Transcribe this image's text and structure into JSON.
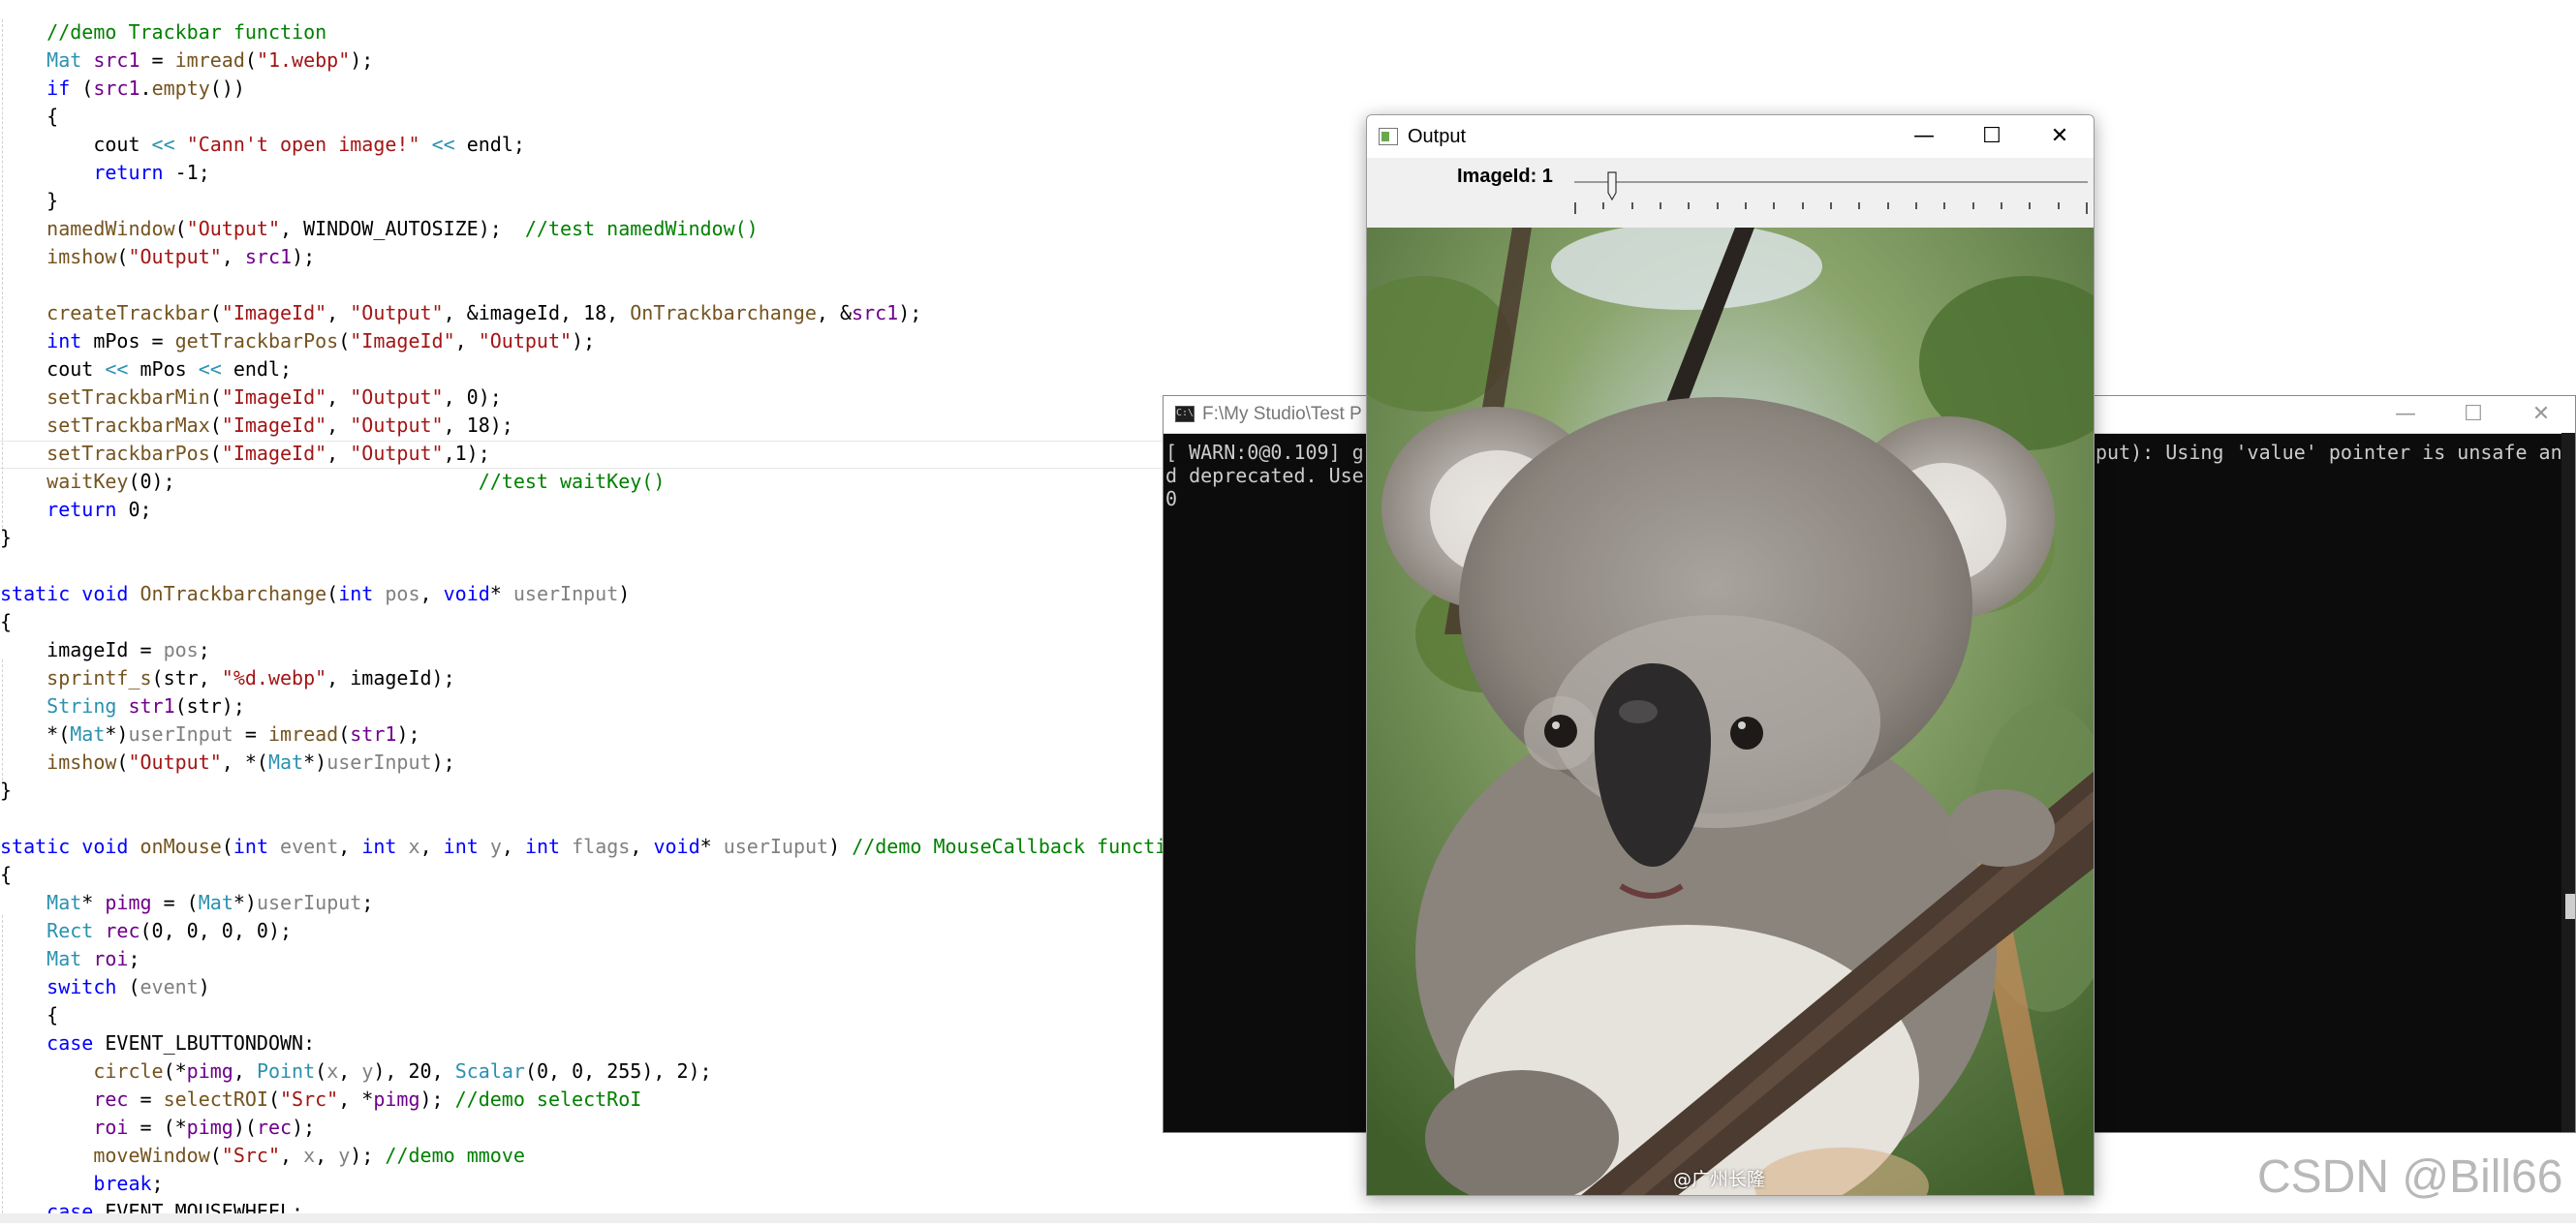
{
  "editor": {
    "lines": [
      [
        {
          "t": "    "
        },
        {
          "t": "//demo Trackbar function",
          "c": "cm"
        }
      ],
      [
        {
          "t": "    "
        },
        {
          "t": "Mat",
          "c": "ty"
        },
        {
          "t": " "
        },
        {
          "t": "src1",
          "c": "mc"
        },
        {
          "t": " = "
        },
        {
          "t": "imread",
          "c": "fn"
        },
        {
          "t": "("
        },
        {
          "t": "\"1.webp\"",
          "c": "st"
        },
        {
          "t": ");"
        }
      ],
      [
        {
          "t": "    "
        },
        {
          "t": "if",
          "c": "kw"
        },
        {
          "t": " ("
        },
        {
          "t": "src1",
          "c": "mc"
        },
        {
          "t": "."
        },
        {
          "t": "empty",
          "c": "fn"
        },
        {
          "t": "())"
        }
      ],
      [
        {
          "t": "    {"
        }
      ],
      [
        {
          "t": "        cout "
        },
        {
          "t": "<<",
          "c": "ty"
        },
        {
          "t": " "
        },
        {
          "t": "\"Cann't open image!\"",
          "c": "st"
        },
        {
          "t": " "
        },
        {
          "t": "<<",
          "c": "ty"
        },
        {
          "t": " endl;"
        }
      ],
      [
        {
          "t": "        "
        },
        {
          "t": "return",
          "c": "kw"
        },
        {
          "t": " -1;"
        }
      ],
      [
        {
          "t": "    }"
        }
      ],
      [
        {
          "t": "    "
        },
        {
          "t": "namedWindow",
          "c": "fn"
        },
        {
          "t": "("
        },
        {
          "t": "\"Output\"",
          "c": "st"
        },
        {
          "t": ", WINDOW_AUTOSIZE);  "
        },
        {
          "t": "//test namedWindow()",
          "c": "cm"
        }
      ],
      [
        {
          "t": "    "
        },
        {
          "t": "imshow",
          "c": "fn"
        },
        {
          "t": "("
        },
        {
          "t": "\"Output\"",
          "c": "st"
        },
        {
          "t": ", "
        },
        {
          "t": "src1",
          "c": "mc"
        },
        {
          "t": ");"
        }
      ],
      [
        {
          "t": ""
        }
      ],
      [
        {
          "t": "    "
        },
        {
          "t": "createTrackbar",
          "c": "fn"
        },
        {
          "t": "("
        },
        {
          "t": "\"ImageId\"",
          "c": "st"
        },
        {
          "t": ", "
        },
        {
          "t": "\"Output\"",
          "c": "st"
        },
        {
          "t": ", &imageId, 18, "
        },
        {
          "t": "OnTrackbarchange",
          "c": "fn"
        },
        {
          "t": ", &"
        },
        {
          "t": "src1",
          "c": "mc"
        },
        {
          "t": ");"
        }
      ],
      [
        {
          "t": "    "
        },
        {
          "t": "int",
          "c": "kw"
        },
        {
          "t": " mPos = "
        },
        {
          "t": "getTrackbarPos",
          "c": "fn"
        },
        {
          "t": "("
        },
        {
          "t": "\"ImageId\"",
          "c": "st"
        },
        {
          "t": ", "
        },
        {
          "t": "\"Output\"",
          "c": "st"
        },
        {
          "t": ");"
        }
      ],
      [
        {
          "t": "    cout "
        },
        {
          "t": "<<",
          "c": "ty"
        },
        {
          "t": " mPos "
        },
        {
          "t": "<<",
          "c": "ty"
        },
        {
          "t": " endl;"
        }
      ],
      [
        {
          "t": "    "
        },
        {
          "t": "setTrackbarMin",
          "c": "fn"
        },
        {
          "t": "("
        },
        {
          "t": "\"ImageId\"",
          "c": "st"
        },
        {
          "t": ", "
        },
        {
          "t": "\"Output\"",
          "c": "st"
        },
        {
          "t": ", 0);"
        }
      ],
      [
        {
          "t": "    "
        },
        {
          "t": "setTrackbarMax",
          "c": "fn"
        },
        {
          "t": "("
        },
        {
          "t": "\"ImageId\"",
          "c": "st"
        },
        {
          "t": ", "
        },
        {
          "t": "\"Output\"",
          "c": "st"
        },
        {
          "t": ", 18);"
        }
      ],
      [
        {
          "t": "    "
        },
        {
          "t": "setTrackbarPos",
          "c": "fn"
        },
        {
          "t": "("
        },
        {
          "t": "\"ImageId\"",
          "c": "st"
        },
        {
          "t": ", "
        },
        {
          "t": "\"Output\"",
          "c": "st"
        },
        {
          "t": ",1);"
        }
      ],
      [
        {
          "t": "    "
        },
        {
          "t": "waitKey",
          "c": "fn"
        },
        {
          "t": "(0);                          "
        },
        {
          "t": "//test waitKey()",
          "c": "cm"
        }
      ],
      [
        {
          "t": "    "
        },
        {
          "t": "return",
          "c": "kw"
        },
        {
          "t": " 0;"
        }
      ],
      [
        {
          "t": "}"
        }
      ],
      [
        {
          "t": ""
        }
      ],
      [
        {
          "t": "static",
          "c": "kw"
        },
        {
          "t": " "
        },
        {
          "t": "void",
          "c": "kw"
        },
        {
          "t": " "
        },
        {
          "t": "OnTrackbarchange",
          "c": "fn"
        },
        {
          "t": "("
        },
        {
          "t": "int",
          "c": "kw"
        },
        {
          "t": " "
        },
        {
          "t": "pos",
          "c": "pa"
        },
        {
          "t": ", "
        },
        {
          "t": "void",
          "c": "kw"
        },
        {
          "t": "* "
        },
        {
          "t": "userInput",
          "c": "pa"
        },
        {
          "t": ")"
        }
      ],
      [
        {
          "t": "{"
        }
      ],
      [
        {
          "t": "    imageId = "
        },
        {
          "t": "pos",
          "c": "pa"
        },
        {
          "t": ";"
        }
      ],
      [
        {
          "t": "    "
        },
        {
          "t": "sprintf_s",
          "c": "fn"
        },
        {
          "t": "(str, "
        },
        {
          "t": "\"%d.webp\"",
          "c": "st"
        },
        {
          "t": ", imageId);"
        }
      ],
      [
        {
          "t": "    "
        },
        {
          "t": "String",
          "c": "ty"
        },
        {
          "t": " "
        },
        {
          "t": "str1",
          "c": "mc"
        },
        {
          "t": "(str);"
        }
      ],
      [
        {
          "t": "    *("
        },
        {
          "t": "Mat",
          "c": "ty"
        },
        {
          "t": "*)"
        },
        {
          "t": "userInput",
          "c": "pa"
        },
        {
          "t": " = "
        },
        {
          "t": "imread",
          "c": "fn"
        },
        {
          "t": "("
        },
        {
          "t": "str1",
          "c": "mc"
        },
        {
          "t": ");"
        }
      ],
      [
        {
          "t": "    "
        },
        {
          "t": "imshow",
          "c": "fn"
        },
        {
          "t": "("
        },
        {
          "t": "\"Output\"",
          "c": "st"
        },
        {
          "t": ", *("
        },
        {
          "t": "Mat",
          "c": "ty"
        },
        {
          "t": "*)"
        },
        {
          "t": "userInput",
          "c": "pa"
        },
        {
          "t": ");"
        }
      ],
      [
        {
          "t": "}"
        }
      ],
      [
        {
          "t": ""
        }
      ],
      [
        {
          "t": "static",
          "c": "kw"
        },
        {
          "t": " "
        },
        {
          "t": "void",
          "c": "kw"
        },
        {
          "t": " "
        },
        {
          "t": "onMouse",
          "c": "fn"
        },
        {
          "t": "("
        },
        {
          "t": "int",
          "c": "kw"
        },
        {
          "t": " "
        },
        {
          "t": "event",
          "c": "pa"
        },
        {
          "t": ", "
        },
        {
          "t": "int",
          "c": "kw"
        },
        {
          "t": " "
        },
        {
          "t": "x",
          "c": "pa"
        },
        {
          "t": ", "
        },
        {
          "t": "int",
          "c": "kw"
        },
        {
          "t": " "
        },
        {
          "t": "y",
          "c": "pa"
        },
        {
          "t": ", "
        },
        {
          "t": "int",
          "c": "kw"
        },
        {
          "t": " "
        },
        {
          "t": "flags",
          "c": "pa"
        },
        {
          "t": ", "
        },
        {
          "t": "void",
          "c": "kw"
        },
        {
          "t": "* "
        },
        {
          "t": "userIuput",
          "c": "pa"
        },
        {
          "t": ") "
        },
        {
          "t": "//demo MouseCallback function",
          "c": "cm"
        }
      ],
      [
        {
          "t": "{"
        }
      ],
      [
        {
          "t": "    "
        },
        {
          "t": "Mat",
          "c": "ty"
        },
        {
          "t": "* "
        },
        {
          "t": "pimg",
          "c": "mc"
        },
        {
          "t": " = ("
        },
        {
          "t": "Mat",
          "c": "ty"
        },
        {
          "t": "*)"
        },
        {
          "t": "userIuput",
          "c": "pa"
        },
        {
          "t": ";"
        }
      ],
      [
        {
          "t": "    "
        },
        {
          "t": "Rect",
          "c": "ty"
        },
        {
          "t": " "
        },
        {
          "t": "rec",
          "c": "mc"
        },
        {
          "t": "(0, 0, 0, 0);"
        }
      ],
      [
        {
          "t": "    "
        },
        {
          "t": "Mat",
          "c": "ty"
        },
        {
          "t": " "
        },
        {
          "t": "roi",
          "c": "mc"
        },
        {
          "t": ";"
        }
      ],
      [
        {
          "t": "    "
        },
        {
          "t": "switch",
          "c": "kw"
        },
        {
          "t": " ("
        },
        {
          "t": "event",
          "c": "pa"
        },
        {
          "t": ")"
        }
      ],
      [
        {
          "t": "    {"
        }
      ],
      [
        {
          "t": "    "
        },
        {
          "t": "case",
          "c": "kw"
        },
        {
          "t": " EVENT_LBUTTONDOWN:"
        }
      ],
      [
        {
          "t": "        "
        },
        {
          "t": "circle",
          "c": "fn"
        },
        {
          "t": "(*"
        },
        {
          "t": "pimg",
          "c": "mc"
        },
        {
          "t": ", "
        },
        {
          "t": "Point",
          "c": "ty"
        },
        {
          "t": "("
        },
        {
          "t": "x",
          "c": "pa"
        },
        {
          "t": ", "
        },
        {
          "t": "y",
          "c": "pa"
        },
        {
          "t": "), 20, "
        },
        {
          "t": "Scalar",
          "c": "ty"
        },
        {
          "t": "(0, 0, 255), 2);"
        }
      ],
      [
        {
          "t": "        "
        },
        {
          "t": "rec",
          "c": "mc"
        },
        {
          "t": " = "
        },
        {
          "t": "selectROI",
          "c": "fn"
        },
        {
          "t": "("
        },
        {
          "t": "\"Src\"",
          "c": "st"
        },
        {
          "t": ", *"
        },
        {
          "t": "pimg",
          "c": "mc"
        },
        {
          "t": "); "
        },
        {
          "t": "//demo selectRoI",
          "c": "cm"
        }
      ],
      [
        {
          "t": "        "
        },
        {
          "t": "roi",
          "c": "mc"
        },
        {
          "t": " = (*"
        },
        {
          "t": "pimg",
          "c": "mc"
        },
        {
          "t": ")("
        },
        {
          "t": "rec",
          "c": "mc"
        },
        {
          "t": ");"
        }
      ],
      [
        {
          "t": "        "
        },
        {
          "t": "moveWindow",
          "c": "fn"
        },
        {
          "t": "("
        },
        {
          "t": "\"Src\"",
          "c": "st"
        },
        {
          "t": ", "
        },
        {
          "t": "x",
          "c": "pa"
        },
        {
          "t": ", "
        },
        {
          "t": "y",
          "c": "pa"
        },
        {
          "t": "); "
        },
        {
          "t": "//demo mmove",
          "c": "cm"
        }
      ],
      [
        {
          "t": "        "
        },
        {
          "t": "break",
          "c": "kw"
        },
        {
          "t": ";"
        }
      ],
      [
        {
          "t": "    "
        },
        {
          "t": "case",
          "c": "kw"
        },
        {
          "t": " EVENT_MOUSEWHEEL:"
        }
      ]
    ]
  },
  "console": {
    "title": "F:\\My Studio\\Test P",
    "icon": "console-app-icon",
    "lines": [
      "[ WARN:0@0.109] g",
      "d deprecated. Use",
      "0"
    ],
    "right_lines": [
      "put): Using 'value' pointer is unsafe an"
    ],
    "minimize": "—",
    "maximize": "☐",
    "close": "✕"
  },
  "output_window": {
    "title": "Output",
    "icon": "opencv-window-icon",
    "minimize": "—",
    "maximize": "☐",
    "close": "✕",
    "trackbar": {
      "label": "ImageId: 1",
      "value": 1,
      "min": 0,
      "max": 18
    },
    "photo_watermark": "@广州长隆"
  },
  "page_watermark": "CSDN @Bill66"
}
